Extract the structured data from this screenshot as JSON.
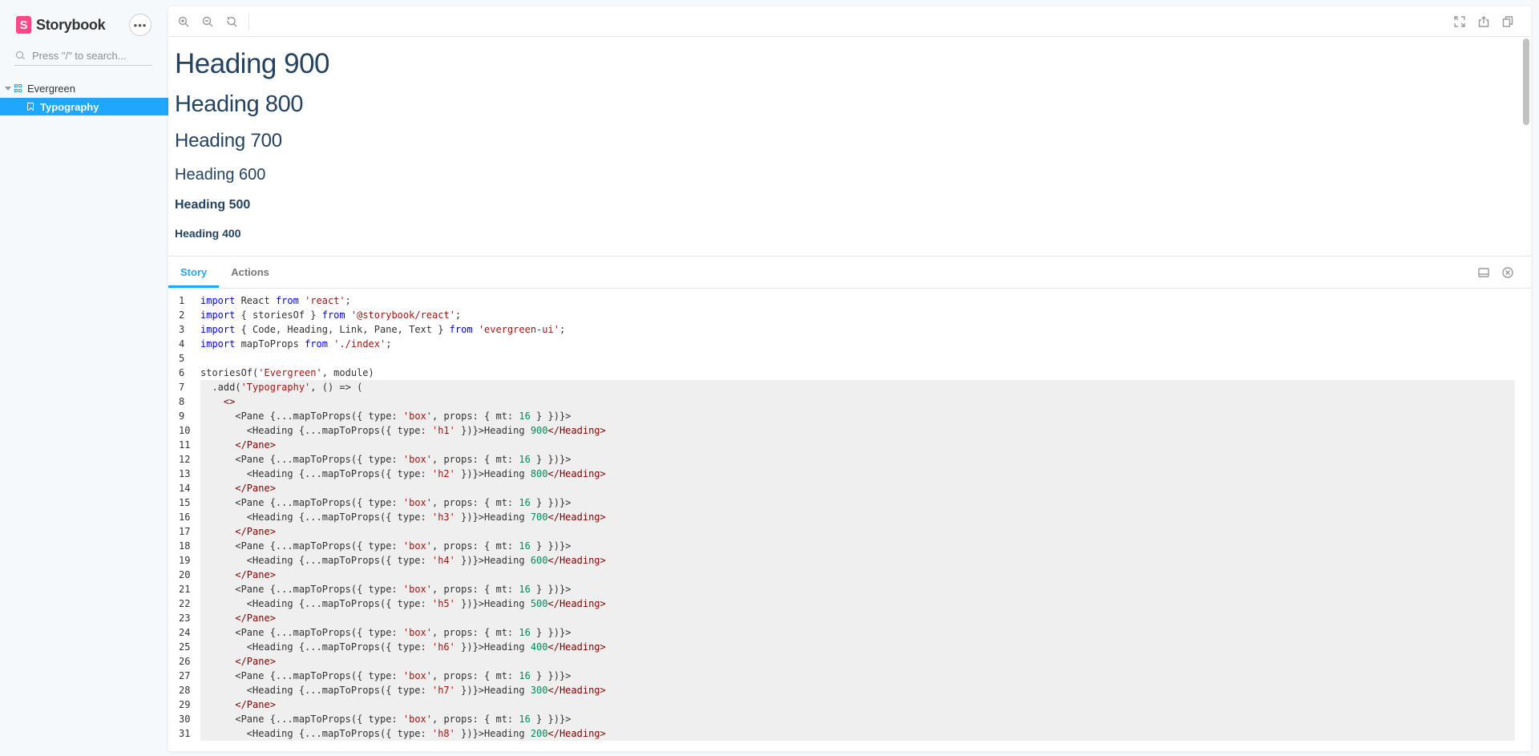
{
  "sidebar": {
    "brand": "Storybook",
    "brand_logo_letter": "S",
    "menu_button": "•••",
    "search_placeholder": "Press \"/\" to search...",
    "tree": {
      "group_label": "Evergreen",
      "active_item": "Typography"
    }
  },
  "toolbar": {
    "left_icons": [
      "zoom-in-icon",
      "zoom-out-icon",
      "zoom-reset-icon"
    ],
    "right_icons": [
      "fullscreen-icon",
      "share-icon",
      "copy-icon"
    ]
  },
  "preview": {
    "headings": [
      "Heading 900",
      "Heading 800",
      "Heading 700",
      "Heading 600",
      "Heading 500",
      "Heading 400"
    ]
  },
  "addons": {
    "tabs": [
      "Story",
      "Actions"
    ],
    "active_tab": "Story",
    "right_icons": [
      "panel-orientation-icon",
      "close-panel-icon"
    ]
  },
  "code": {
    "lines": [
      "import React from 'react';",
      "import { storiesOf } from '@storybook/react';",
      "import { Code, Heading, Link, Pane, Text } from 'evergreen-ui';",
      "import mapToProps from './index';",
      "",
      "storiesOf('Evergreen', module)",
      "  .add('Typography', () => (",
      "    <>",
      "      <Pane {...mapToProps({ type: 'box', props: { mt: 16 } })}>",
      "        <Heading {...mapToProps({ type: 'h1' })}>Heading 900</Heading>",
      "      </Pane>",
      "      <Pane {...mapToProps({ type: 'box', props: { mt: 16 } })}>",
      "        <Heading {...mapToProps({ type: 'h2' })}>Heading 800</Heading>",
      "      </Pane>",
      "      <Pane {...mapToProps({ type: 'box', props: { mt: 16 } })}>",
      "        <Heading {...mapToProps({ type: 'h3' })}>Heading 700</Heading>",
      "      </Pane>",
      "      <Pane {...mapToProps({ type: 'box', props: { mt: 16 } })}>",
      "        <Heading {...mapToProps({ type: 'h4' })}>Heading 600</Heading>",
      "      </Pane>",
      "      <Pane {...mapToProps({ type: 'box', props: { mt: 16 } })}>",
      "        <Heading {...mapToProps({ type: 'h5' })}>Heading 500</Heading>",
      "      </Pane>",
      "      <Pane {...mapToProps({ type: 'box', props: { mt: 16 } })}>",
      "        <Heading {...mapToProps({ type: 'h6' })}>Heading 400</Heading>",
      "      </Pane>",
      "      <Pane {...mapToProps({ type: 'box', props: { mt: 16 } })}>",
      "        <Heading {...mapToProps({ type: 'h7' })}>Heading 300</Heading>",
      "      </Pane>",
      "      <Pane {...mapToProps({ type: 'box', props: { mt: 16 } })}>",
      "        <Heading {...mapToProps({ type: 'h8' })}>Heading 200</Heading>"
    ],
    "highlight_from_line": 7
  },
  "colors": {
    "accent": "#1ea7fd",
    "brand": "#ff4785",
    "heading": "#234361"
  }
}
